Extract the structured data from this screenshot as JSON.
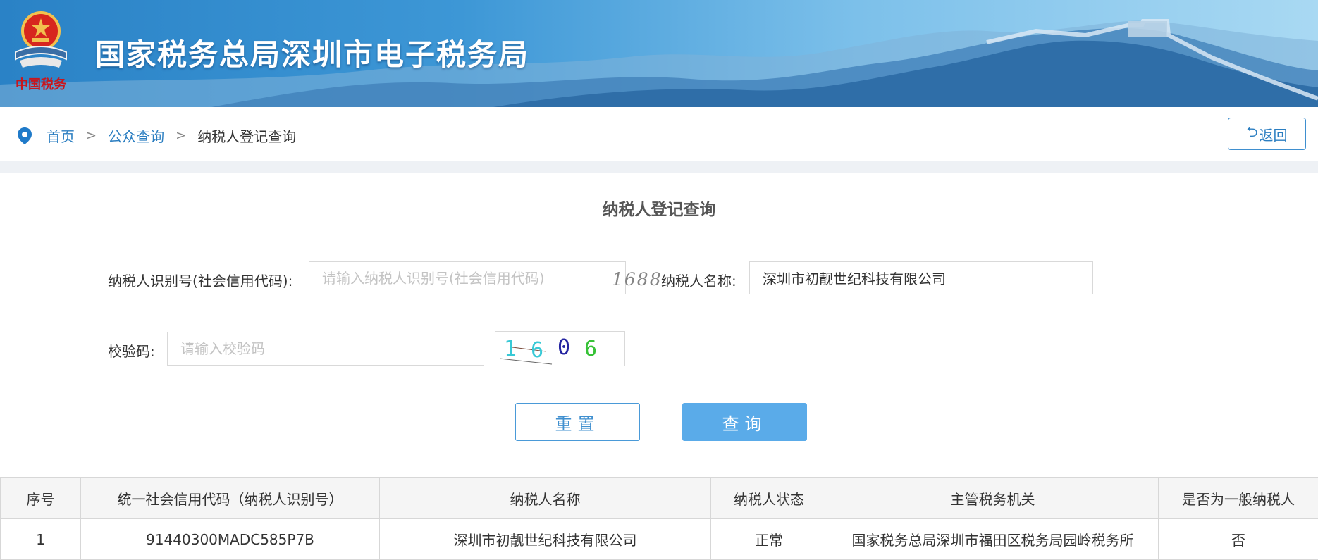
{
  "header": {
    "site_title": "国家税务总局深圳市电子税务局",
    "emblem_caption": "中国税务"
  },
  "breadcrumb": {
    "home": "首页",
    "section": "公众查询",
    "current": "纳税人登记查询",
    "separator": ">"
  },
  "back_button": {
    "label": "返回",
    "icon": "return-arrow-icon"
  },
  "form": {
    "title": "纳税人登记查询",
    "taxpayer_id": {
      "label": "纳税人识别号(社会信用代码):",
      "placeholder": "请输入纳税人识别号(社会信用代码)",
      "value": ""
    },
    "taxpayer_name": {
      "label": "纳税人名称:",
      "placeholder": "",
      "value": "深圳市初靓世纪科技有限公司"
    },
    "captcha": {
      "label": "校验码:",
      "placeholder": "请输入校验码",
      "value": "",
      "image_text": [
        "1",
        "6",
        "0",
        "6"
      ],
      "image_colors": [
        "#38c9d6",
        "#38c9d6",
        "#2323a0",
        "#36c236"
      ]
    },
    "reset_label": "重置",
    "query_label": "查询",
    "watermark": "1688"
  },
  "results": {
    "columns": [
      "序号",
      "统一社会信用代码（纳税人识别号）",
      "纳税人名称",
      "纳税人状态",
      "主管税务机关",
      "是否为一般纳税人"
    ],
    "rows": [
      [
        "1",
        "91440300MADC585P7B",
        "深圳市初靓世纪科技有限公司",
        "正常",
        "国家税务总局深圳市福田区税务局园岭税务所",
        "否"
      ]
    ]
  },
  "colors": {
    "accent": "#2b7ec1",
    "query_button": "#5aabe9",
    "banner_dark": "#2a82c6",
    "banner_light": "#a9d9f3"
  }
}
